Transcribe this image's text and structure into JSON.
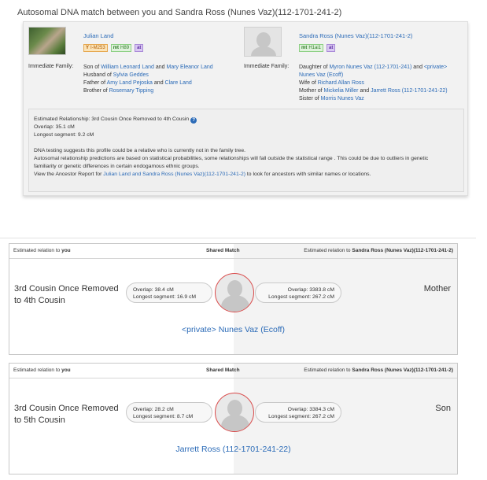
{
  "page": {
    "title": "Autosomal DNA match between you and Sandra Ross (Nunes Vaz)(112-1701-241-2)"
  },
  "you": {
    "name": "Julian Land",
    "badges": [
      {
        "key": "Y",
        "value": "I-M253"
      },
      {
        "key": "mt",
        "value": "H89"
      },
      {
        "key": "at",
        "value": ""
      }
    ],
    "family_label": "Immediate Family:",
    "family": {
      "son_prefix": "Son of",
      "father": "William Leonard Land",
      "and1": "and",
      "mother": "Mary Eleanor Land",
      "husband_prefix": "Husband of",
      "spouse": "Sylvia Geddes",
      "father_prefix": "Father of",
      "child1": "Amy Land Pejoska",
      "and2": "and",
      "child2": "Clare Land",
      "brother_prefix": "Brother of",
      "sibling": "Rosemary Tipping"
    }
  },
  "match": {
    "name": "Sandra Ross (Nunes Vaz)(112-1701-241-2)",
    "badges": [
      {
        "key": "mt",
        "value": "H1ai1"
      },
      {
        "key": "at",
        "value": ""
      }
    ],
    "family_label": "Immediate Family:",
    "family": {
      "daughter_prefix": "Daughter of",
      "father": "Myron Nunes Vaz (112-1701-241)",
      "and1": "and",
      "mother_line1": "<private>",
      "mother_line2": "Nunes Vaz (Ecoff)",
      "wife_prefix": "Wife of",
      "spouse": "Richard Allan Ross",
      "mother_prefix": "Mother of",
      "child1": "Mickelia Miller",
      "and2": "and",
      "child2": "Jarrett Ross (112-1701-241-22)",
      "sister_prefix": "Sister of",
      "sibling": "Morris Nunes Vaz"
    }
  },
  "estimate": {
    "relationship": "Estimated Relationship: 3rd Cousin Once Removed to 4th Cousin",
    "overlap": "Overlap: 35.1 cM",
    "longest": "Longest segment: 9.2 cM",
    "note1": "DNA testing suggests this profile could be a relative who is currently not in the family tree.",
    "note2": "Autosomal relationship predictions are based on statistical probabilities, some relationships will fall outside the statistical range . This could be due to outliers in genetic",
    "note3": "familiarity or genetic differences in certain endogamous ethnic groups.",
    "note4_prefix": "View the Ancestor Report for",
    "note4_link": "Julian Land and Sandra Ross (Nunes Vaz)(112-1701-241-2)",
    "note4_suffix": "to look for ancestors with similar names or locations."
  },
  "shared_matches": [
    {
      "hdr_left_prefix": "Estimated relation to",
      "hdr_left_bold": "you",
      "hdr_center": "Shared Match",
      "hdr_right_prefix": "Estimated relation to",
      "hdr_right_bold": "Sandra Ross (Nunes Vaz)(112-1701-241-2)",
      "relation_you": "3rd Cousin Once Removed to 4th Cousin",
      "overlap_you": "Overlap: 38.4 cM",
      "longest_you": "Longest segment: 16.9 cM",
      "overlap_match": "Overlap: 3383.8 cM",
      "longest_match": "Longest segment: 267.2 cM",
      "relation_match": "Mother",
      "name": "<private> Nunes Vaz (Ecoff)"
    },
    {
      "hdr_left_prefix": "Estimated relation to",
      "hdr_left_bold": "you",
      "hdr_center": "Shared Match",
      "hdr_right_prefix": "Estimated relation to",
      "hdr_right_bold": "Sandra Ross (Nunes Vaz)(112-1701-241-2)",
      "relation_you": "3rd Cousin Once Removed to 5th Cousin",
      "overlap_you": "Overlap: 28.2 cM",
      "longest_you": "Longest segment: 8.7 cM",
      "overlap_match": "Overlap: 3384.3 cM",
      "longest_match": "Longest segment: 267.2 cM",
      "relation_match": "Son",
      "name": "Jarrett Ross (112-1701-241-22)"
    }
  ],
  "colors": {
    "link": "#2a6ab7",
    "circle_border": "#d94a4a"
  }
}
